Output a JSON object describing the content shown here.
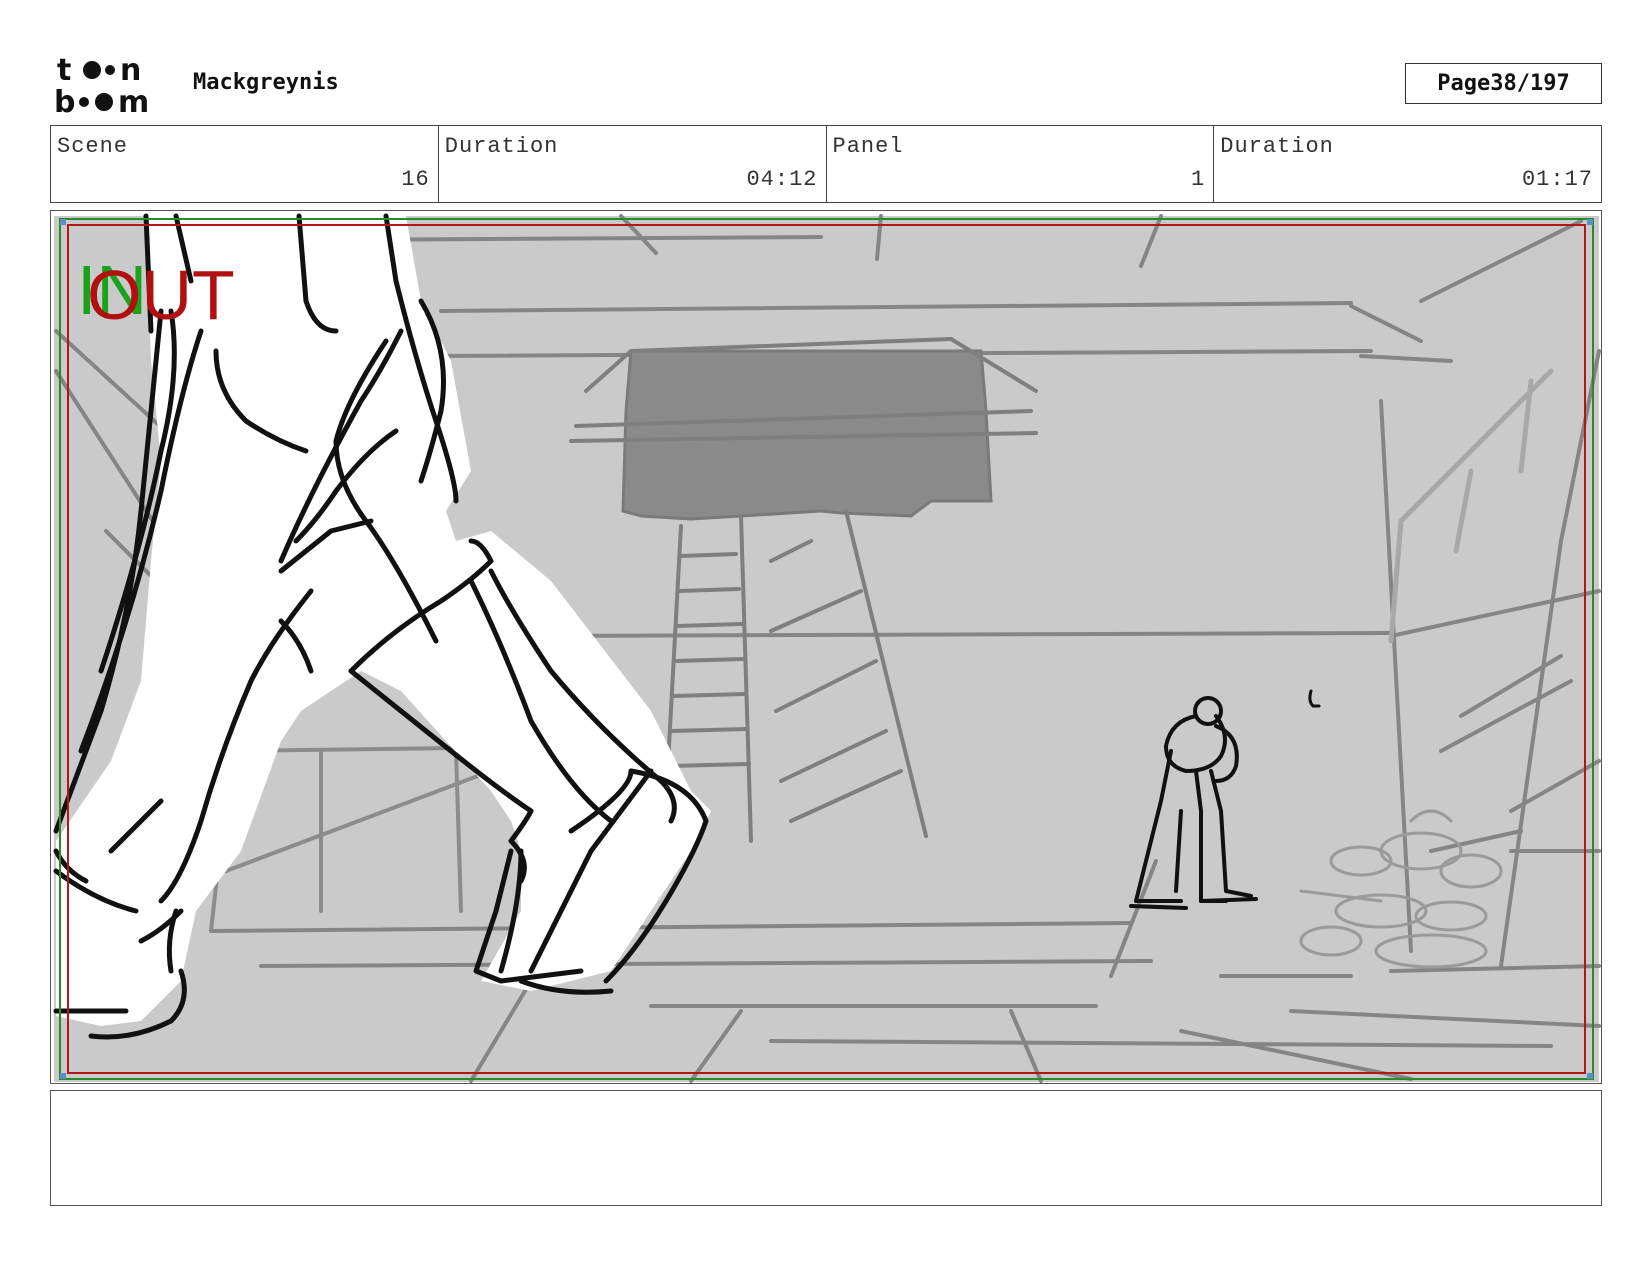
{
  "header": {
    "logo_text": "toon boom",
    "project_name": "Mackgreynis",
    "page_label": "Page",
    "page_number": "38/197"
  },
  "info": {
    "scene_label": "Scene",
    "scene_value": "16",
    "scene_duration_label": "Duration",
    "scene_duration_value": "04:12",
    "panel_label": "Panel",
    "panel_value": "1",
    "panel_duration_label": "Duration",
    "panel_duration_value": "01:17"
  },
  "panel_markers": {
    "in_label": "IN",
    "out_label": "OUT",
    "in_color": "#1aa31a",
    "out_color": "#b01010"
  },
  "notes": {
    "text": ""
  }
}
